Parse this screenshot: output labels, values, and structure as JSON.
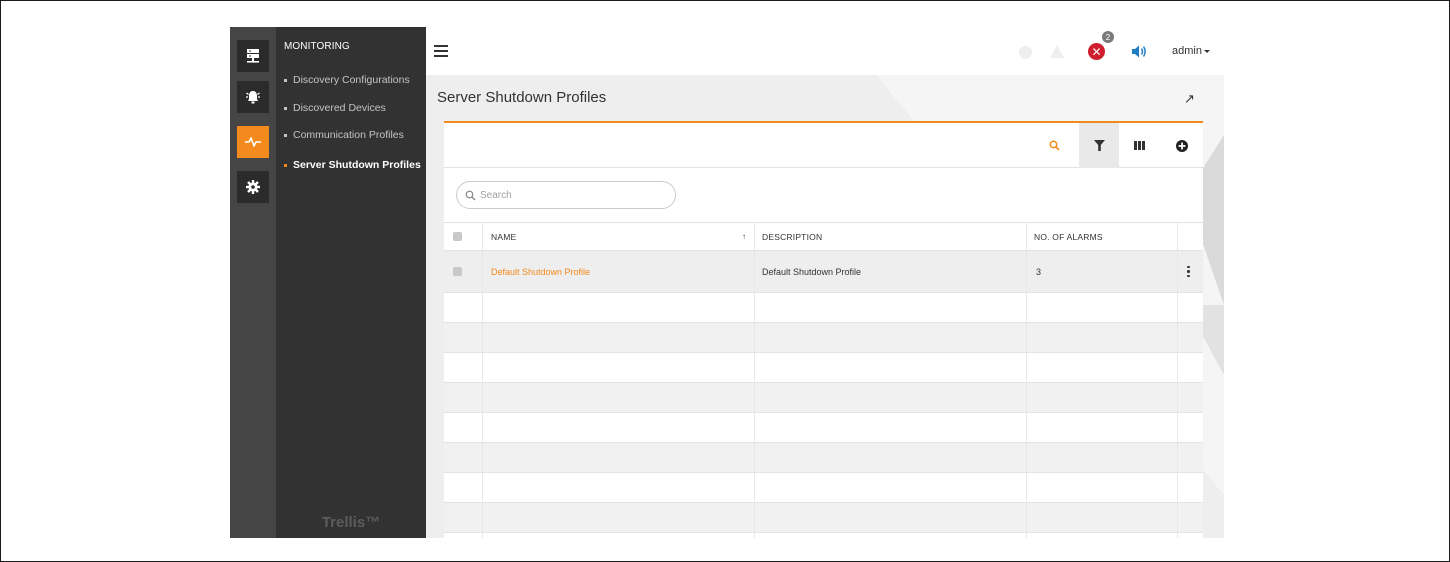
{
  "sidebar": {
    "rail_icons": [
      "server-icon",
      "alarm-icon",
      "monitoring-pulse-icon",
      "settings-gear-icon"
    ],
    "section_title": "MONITORING",
    "items": [
      {
        "label": "Discovery Configurations",
        "active": false
      },
      {
        "label": "Discovered Devices",
        "active": false
      },
      {
        "label": "Communication Profiles",
        "active": false
      },
      {
        "label": "Server Shutdown Profiles",
        "active": true
      }
    ],
    "brand": "Trellis™"
  },
  "header": {
    "error_count": "2",
    "user": "admin"
  },
  "page": {
    "title": "Server Shutdown Profiles"
  },
  "search": {
    "placeholder": "Search"
  },
  "table": {
    "columns": {
      "name": "NAME",
      "description": "DESCRIPTION",
      "alarms": "NO. OF ALARMS"
    },
    "sort_indicator": "↑",
    "rows": [
      {
        "name": "Default Shutdown Profile",
        "description": "Default Shutdown Profile",
        "alarms": "3"
      }
    ]
  },
  "colors": {
    "accent": "#f38a1d",
    "error": "#cf1f2e",
    "info": "#1f7dc4",
    "rail": "#454545",
    "submenu": "#323232"
  }
}
